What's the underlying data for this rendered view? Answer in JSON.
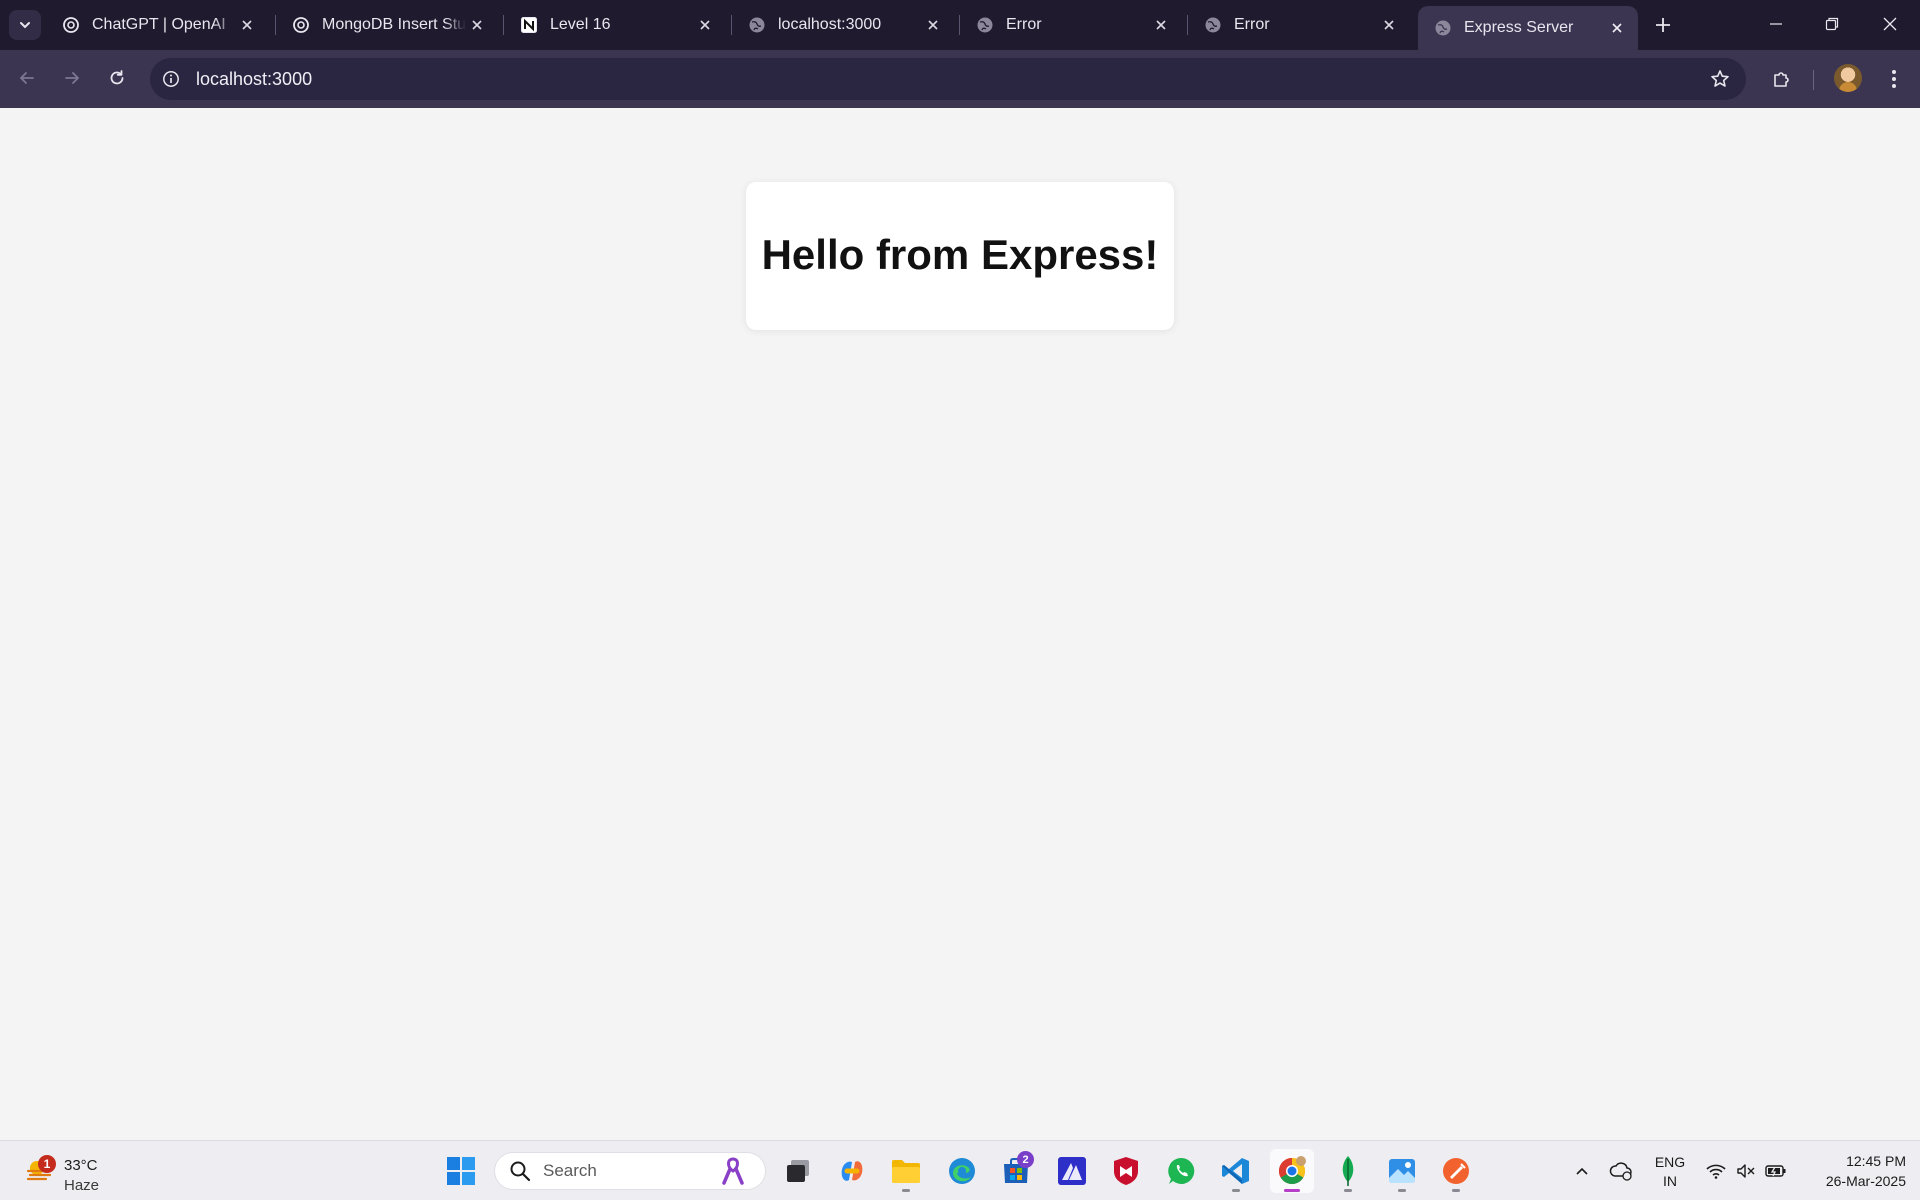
{
  "browser": {
    "tabs": [
      {
        "title": "ChatGPT | OpenAI",
        "icon": "openai-icon"
      },
      {
        "title": "MongoDB Insert Student Data",
        "icon": "openai-icon"
      },
      {
        "title": "Level 16",
        "icon": "notion-icon"
      },
      {
        "title": "localhost:3000",
        "icon": "globe-icon"
      },
      {
        "title": "Error",
        "icon": "globe-icon"
      },
      {
        "title": "Error",
        "icon": "globe-icon"
      },
      {
        "title": "Express Server",
        "icon": "globe-icon",
        "active": true
      }
    ],
    "address": "localhost:3000"
  },
  "page": {
    "heading": "Hello from Express!"
  },
  "taskbar": {
    "weather": {
      "temp": "33°C",
      "condition": "Haze",
      "badge": "1"
    },
    "search_placeholder": "Search",
    "store_badge": "2",
    "lang_line1": "ENG",
    "lang_line2": "IN",
    "time": "12:45 PM",
    "date": "26-Mar-2025"
  },
  "colors": {
    "tabstrip": "#1f1a2e",
    "toolbar": "#3b3551",
    "page_bg": "#f4f4f4",
    "card_bg": "#ffffff"
  }
}
